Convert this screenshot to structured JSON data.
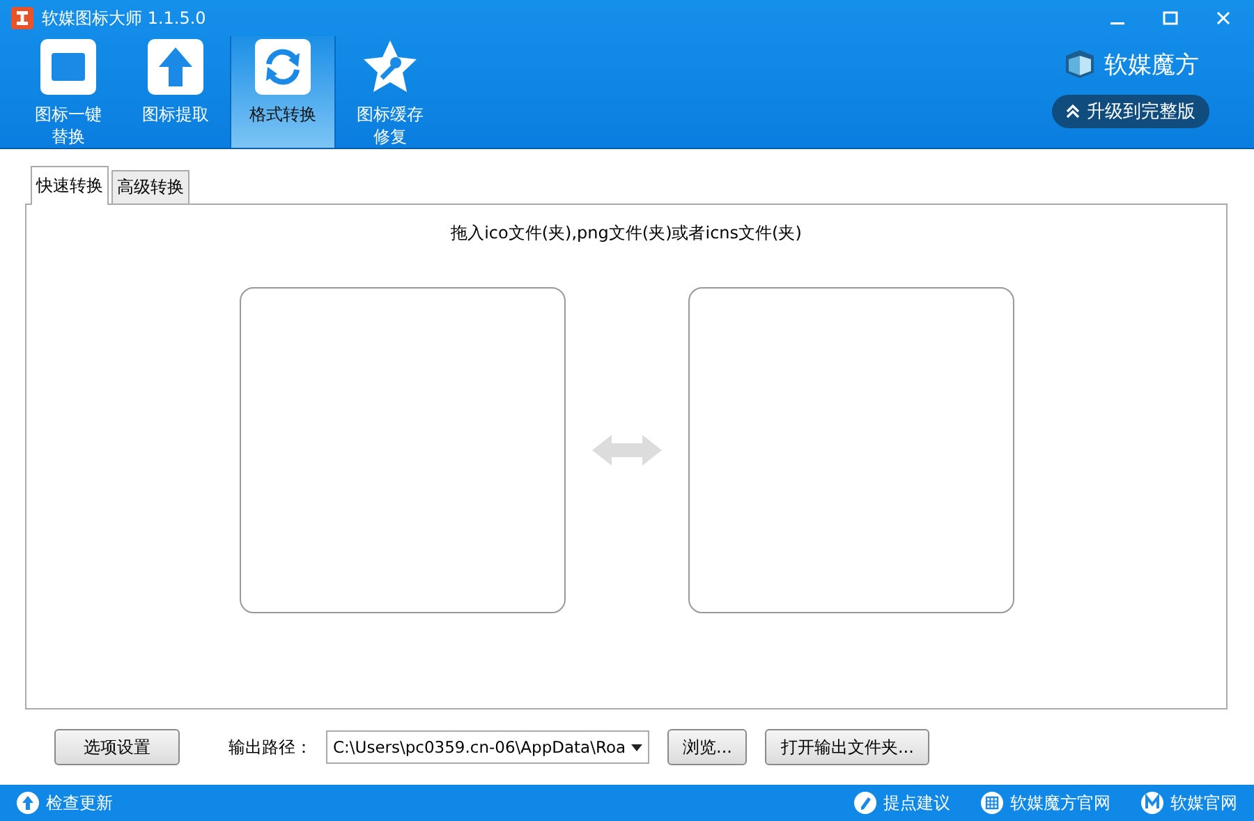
{
  "window": {
    "title": "软媒图标大师 1.1.5.0"
  },
  "toolbar": [
    {
      "label": [
        "图标一键",
        "替换"
      ],
      "kind": "replace",
      "selected": false
    },
    {
      "label": [
        "图标提取"
      ],
      "kind": "extract",
      "selected": false
    },
    {
      "label": [
        "格式转换"
      ],
      "kind": "convert",
      "selected": true
    },
    {
      "label": [
        "图标缓存",
        "修复"
      ],
      "kind": "repair",
      "selected": false
    }
  ],
  "brand": {
    "name": "软媒魔方",
    "upgrade": "升级到完整版"
  },
  "tabs": [
    {
      "label": "快速转换",
      "selected": true
    },
    {
      "label": "高级转换",
      "selected": false
    }
  ],
  "hint": "拖入ico文件(夹),png文件(夹)或者icns文件(夹)",
  "options_button": "选项设置",
  "output": {
    "label": "输出路径：",
    "value": "C:\\Users\\pc0359.cn-06\\AppData\\Roa",
    "browse": "浏览...",
    "open": "打开输出文件夹..."
  },
  "status_bar": {
    "update": "检查更新",
    "links": [
      {
        "label": "提点建议",
        "kind": "feedback"
      },
      {
        "label": "软媒魔方官网",
        "kind": "grid"
      },
      {
        "label": "软媒官网",
        "kind": "m"
      }
    ]
  }
}
